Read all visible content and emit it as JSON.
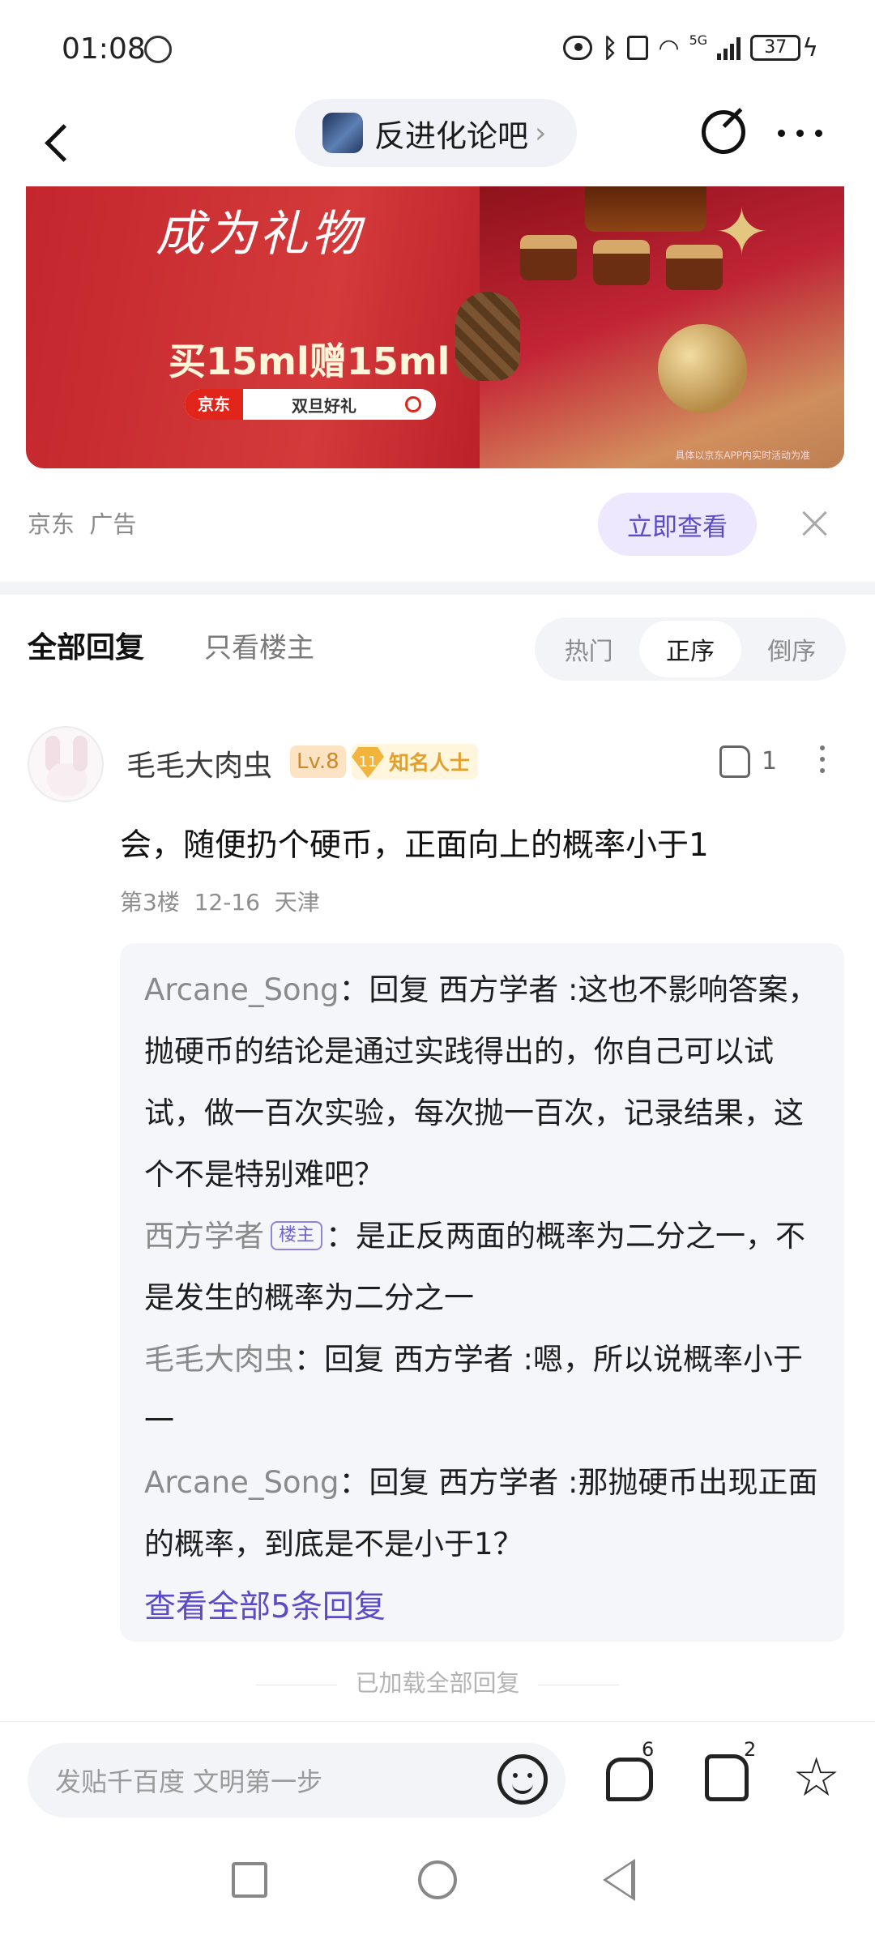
{
  "status_bar": {
    "time": "01:08",
    "network": "5G",
    "battery": "37",
    "icons": [
      "hand-icon",
      "eye-icon",
      "bluetooth-icon",
      "vibrate-icon",
      "wifi-icon",
      "signal-icon",
      "battery-icon",
      "charging-icon"
    ]
  },
  "header": {
    "forum_name": "反进化论吧",
    "chevron": "›"
  },
  "ad": {
    "headline": "成为礼物",
    "offer": "买15ml赠15ml",
    "search_brand": "京东",
    "search_text": "双旦好礼",
    "footnote": "具体以京东APP内实时活动为准",
    "meta": "京东  广告",
    "cta": "立即查看"
  },
  "reply_tabs": {
    "all": "全部回复",
    "op_only": "只看楼主",
    "sort": [
      {
        "label": "热门",
        "active": false
      },
      {
        "label": "正序",
        "active": true
      },
      {
        "label": "倒序",
        "active": false
      }
    ]
  },
  "post": {
    "username": "毛毛大肉虫",
    "level": "Lv.8",
    "badge_number": "11",
    "badge": "知名人士",
    "like_count": "1",
    "body": "会，随便扔个硬币，正面向上的概率小于1",
    "meta": "第3楼  12-16  天津",
    "replies": [
      {
        "name": "Arcane_Song",
        "is_op": false,
        "text": "：回复 西方学者 :这也不影响答案，抛硬币的结论是通过实践得出的，你自己可以试试，做一百次实验，每次抛一百次，记录结果，这个不是特别难吧？"
      },
      {
        "name": "西方学者",
        "is_op": true,
        "op_label": "楼主",
        "text": "：是正反两面的概率为二分之一，不是发生的概率为二分之一"
      },
      {
        "name": "毛毛大肉虫",
        "is_op": false,
        "text": "：回复 西方学者 :嗯，所以说概率小于一"
      },
      {
        "name": "Arcane_Song",
        "is_op": false,
        "text": "：回复 西方学者 :那抛硬币出现正面的概率，到底是不是小于1？"
      }
    ],
    "view_all": "查看全部5条回复"
  },
  "loaded_all": "已加载全部回复",
  "bottom_bar": {
    "input_placeholder": "发贴千百度 文明第一步",
    "comment_count": "6",
    "like_count": "2"
  },
  "colors": {
    "accent": "#5a4bc8",
    "cta_bg": "#ede8fd",
    "ad_red": "#c3262d"
  }
}
